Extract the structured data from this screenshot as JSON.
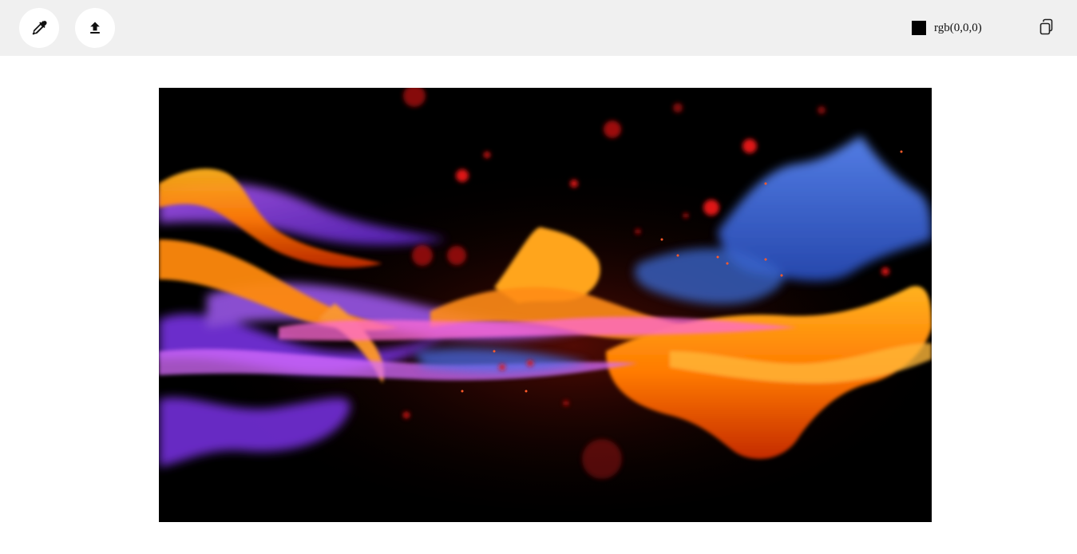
{
  "toolbar": {
    "eyedropper_icon": "eyedropper-icon",
    "upload_icon": "upload-icon",
    "copy_icon": "copy-icon",
    "picked_color": {
      "text": "rgb(0,0,0)",
      "swatch_color": "#000000"
    }
  },
  "canvas": {
    "image_description_colors": {
      "background": "#000000",
      "flame_orange": "#ff7a00",
      "flame_purple": "#8a3cff",
      "flame_blue": "#3f6fe0",
      "embers": "#d01010"
    }
  }
}
